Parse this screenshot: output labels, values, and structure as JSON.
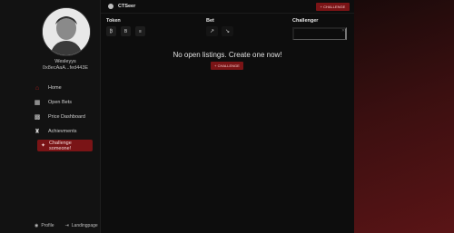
{
  "user": {
    "name": "Wesleyys",
    "address": "0x8ecAaA...fed443E"
  },
  "sidebar": {
    "items": [
      {
        "label": "Home",
        "icon": "home-icon"
      },
      {
        "label": "Open Bets",
        "icon": "calendar-icon"
      },
      {
        "label": "Price Dashboard",
        "icon": "grid-icon"
      },
      {
        "label": "Achievments",
        "icon": "trophy-icon"
      }
    ],
    "cta_label": "Challenge someone!",
    "profile_label": "Profile",
    "landing_label": "Landingpage"
  },
  "header": {
    "title": "CTSeer",
    "challenge_button": "+ CHALLENGE"
  },
  "table": {
    "columns": [
      "Token",
      "Bet",
      "Challenger"
    ],
    "token_buttons": [
      "₿",
      "B",
      "≡"
    ],
    "bet_buttons": [
      "↗",
      "↘"
    ],
    "challenger_value": ""
  },
  "empty": {
    "message": "No open listings. Create one now!",
    "button": "+ CHALLENGE"
  },
  "colors": {
    "accent": "#7a1416",
    "background": "#0b0b0b"
  }
}
